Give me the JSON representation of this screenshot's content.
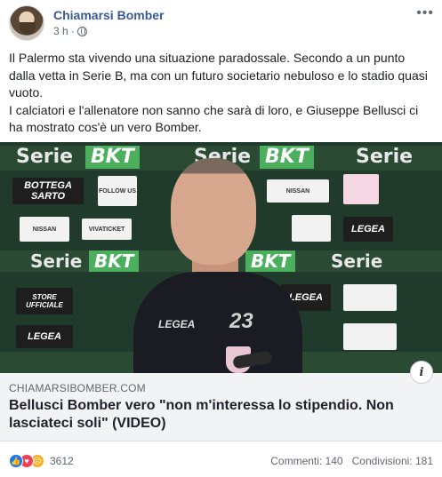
{
  "post": {
    "author": "Chiamarsi Bomber",
    "time": "3 h",
    "separator": "·",
    "privacy_icon": "globe-icon",
    "more_icon": "more-options-icon",
    "more_glyph": "•••",
    "text_line1": "Il Palermo sta vivendo una situazione paradossale. Secondo a un punto dalla vetta in Serie B, ma con un futuro societario nebuloso e lo stadio quasi vuoto.",
    "text_line2": "I calciatori e l'allenatore non sanno che sarà di loro, e Giuseppe Bellusci ci ha mostrato cos'è un vero Bomber."
  },
  "media": {
    "board_serie": "Serie",
    "board_bkt": "BKT",
    "sponsor_bottega": "BOTTEGA SARTO",
    "sponsor_follow": "FOLLOW US",
    "sponsor_nissan": "NISSAN",
    "sponsor_vivaticket": "VIVATICKET",
    "sponsor_legea": "LEGEA",
    "sponsor_store": "STORE UFFICIALE",
    "shirt_brand": "LEGEA",
    "shirt_number": "23",
    "info_glyph": "i"
  },
  "link": {
    "domain": "CHIAMARSIBOMBER.COM",
    "title": "Bellusci Bomber vero \"non m'interessa lo stipendio. Non lasciateci soli\" (VIDEO)"
  },
  "footer": {
    "reaction_count": "3612",
    "comments": "Commenti: 140",
    "shares": "Condivisioni: 181"
  },
  "colors": {
    "author_link": "#385898",
    "like": "#1877f2",
    "love": "#f33e58",
    "sad": "#f7b125",
    "link_bg": "#f2f3f5"
  }
}
